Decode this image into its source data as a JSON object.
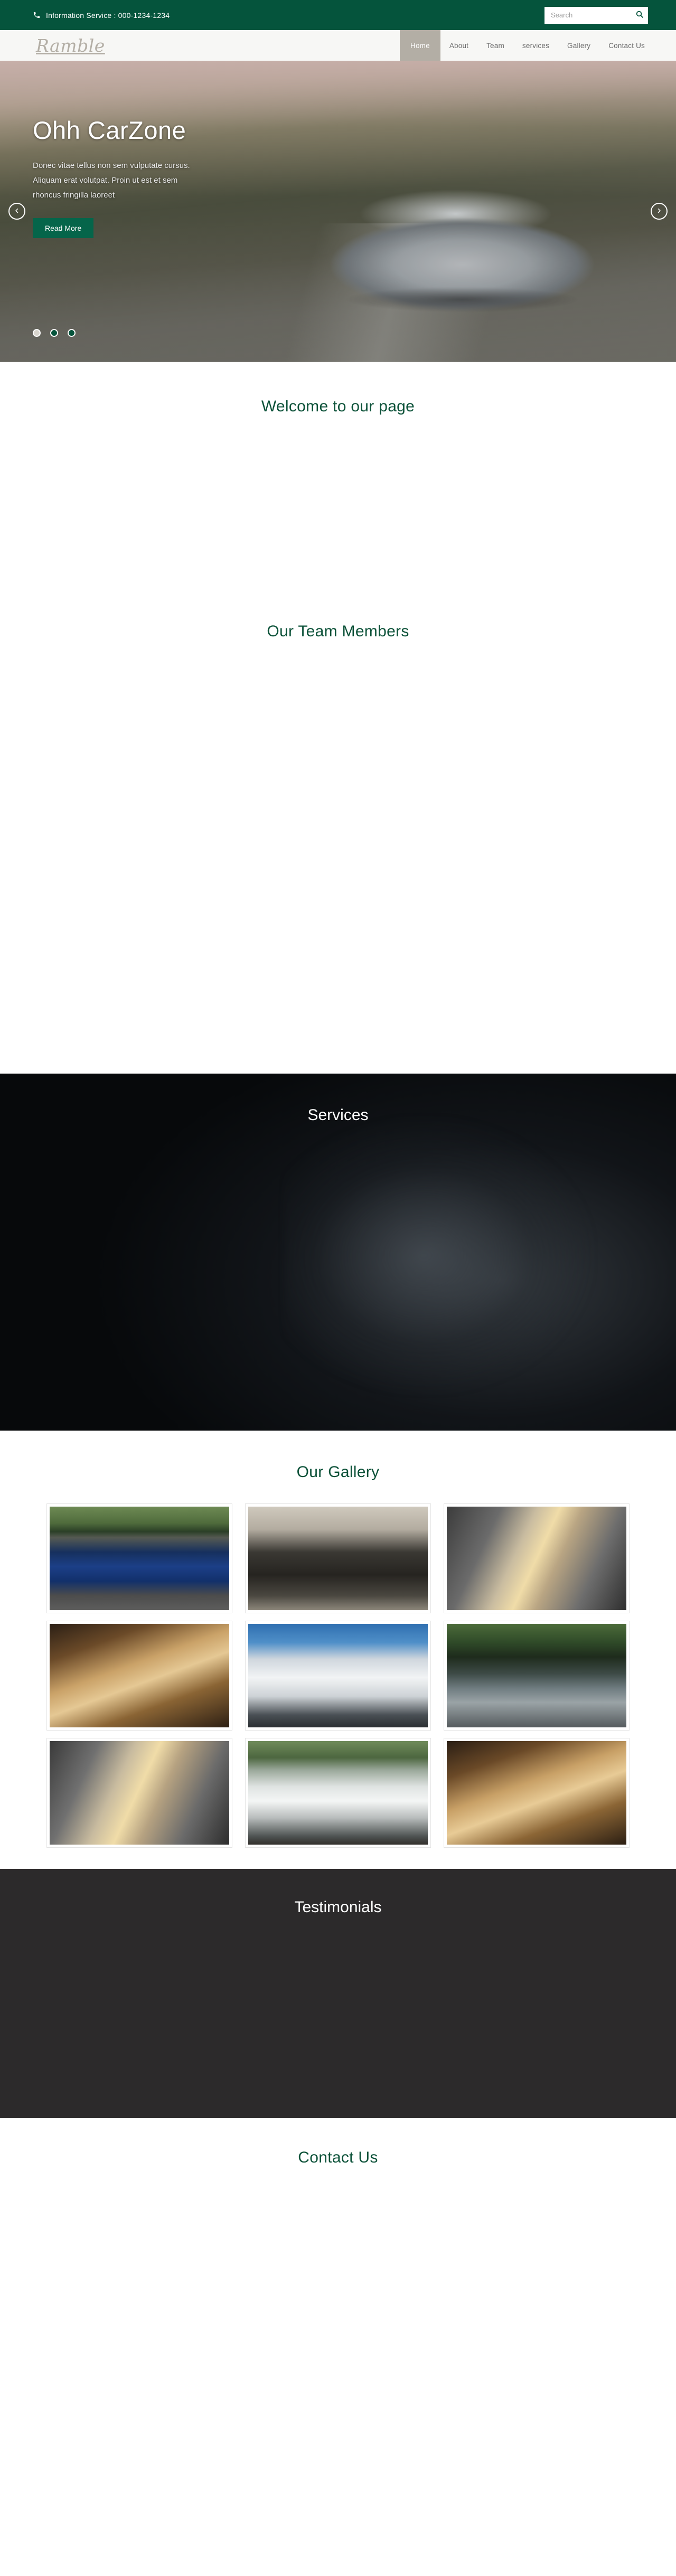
{
  "topbar": {
    "phone_icon": "phone-icon",
    "info_text": "Information Service : 000-1234-1234",
    "search_placeholder": "Search",
    "search_value": "",
    "search_icon": "search-icon",
    "bg_color": "#05543c"
  },
  "header": {
    "logo_text": "Ramble",
    "nav": [
      {
        "label": "Home",
        "active": true
      },
      {
        "label": "About",
        "active": false
      },
      {
        "label": "Team",
        "active": false
      },
      {
        "label": "services",
        "active": false
      },
      {
        "label": "Gallery",
        "active": false
      },
      {
        "label": "Contact Us",
        "active": false
      }
    ],
    "active_bg": "#b3aea5",
    "bg_color": "#f7f7f5"
  },
  "hero": {
    "title": "Ohh CarZone",
    "description": "Donec vitae tellus non sem vulputate cursus. Aliquam erat volutpat. Proin ut est et sem rhoncus fringilla laoreet",
    "button_label": "Read More",
    "button_color": "#05654a",
    "prev_icon": "chevron-left-icon",
    "next_icon": "chevron-right-icon",
    "dots": [
      {
        "active": true
      },
      {
        "active": false
      },
      {
        "active": false
      }
    ]
  },
  "welcome": {
    "title": "Welcome to our page",
    "title_color": "#0b5138"
  },
  "team": {
    "title": "Our Team Members",
    "title_color": "#0b5138"
  },
  "services": {
    "title": "Services",
    "title_color": "#ffffff",
    "bg_color": "#0c0f12"
  },
  "gallery": {
    "title": "Our Gallery",
    "title_color": "#0b5138",
    "items": [
      {
        "name": "blue-sports-car-rear"
      },
      {
        "name": "car-dashboard-interior"
      },
      {
        "name": "silver-car-headlight-closeup"
      },
      {
        "name": "tan-leather-car-interior"
      },
      {
        "name": "white-sports-car-front"
      },
      {
        "name": "black-sedan-parked"
      },
      {
        "name": "silver-car-headlight-detail"
      },
      {
        "name": "white-sports-car-side"
      },
      {
        "name": "beige-leather-seats"
      }
    ]
  },
  "testimonials": {
    "title": "Testimonials",
    "title_color": "#ffffff",
    "bg_color": "#2c2a2b"
  },
  "contact": {
    "title": "Contact Us",
    "title_color": "#0b5138"
  }
}
